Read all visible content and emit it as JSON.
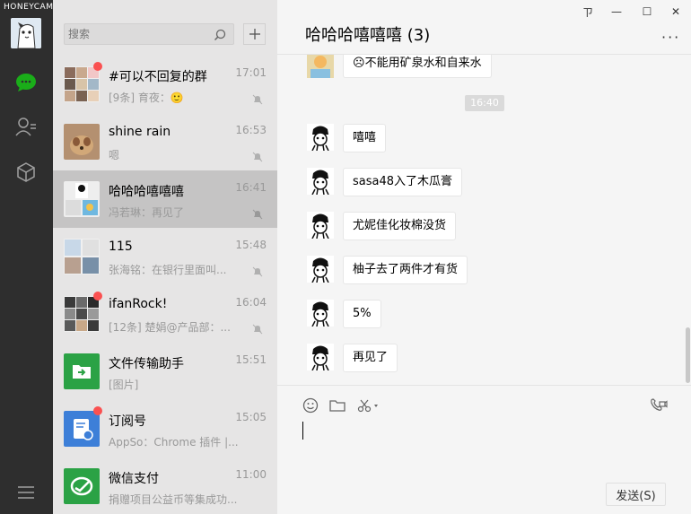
{
  "watermark": "HONEYCAM",
  "search": {
    "placeholder": "搜索"
  },
  "sessions": [
    {
      "name": "#可以不回复的群",
      "time": "17:01",
      "snippet": "[9条] 育夜：🙂",
      "unread": true,
      "muted": true,
      "active": false
    },
    {
      "name": "shine rain",
      "time": "16:53",
      "snippet": "嗯",
      "unread": false,
      "muted": true,
      "active": false
    },
    {
      "name": "哈哈哈嘻嘻嘻",
      "time": "16:41",
      "snippet": "冯若琳：再见了",
      "unread": false,
      "muted": true,
      "active": true
    },
    {
      "name": "115",
      "time": "15:48",
      "snippet": "张海铭：在银行里面叫...",
      "unread": false,
      "muted": true,
      "active": false
    },
    {
      "name": "ifanRock!",
      "time": "16:04",
      "snippet": "[12条] 楚娟@产品部：...",
      "unread": true,
      "muted": true,
      "active": false
    },
    {
      "name": "文件传输助手",
      "time": "15:51",
      "snippet": "[图片]",
      "unread": false,
      "muted": false,
      "active": false
    },
    {
      "name": "订阅号",
      "time": "15:05",
      "snippet": "AppSo：Chrome 插件 |...",
      "unread": true,
      "muted": false,
      "active": false
    },
    {
      "name": "微信支付",
      "time": "11:00",
      "snippet": "捐赠项目公益币等集成功...",
      "unread": false,
      "muted": false,
      "active": false
    }
  ],
  "chat": {
    "title": "哈哈哈嘻嘻嘻 (3)",
    "more_label": "···",
    "time_divider": "16:40",
    "messages": [
      "不能用矿泉水和自来水",
      "嘻嘻",
      "sasa48入了木瓜膏",
      "尤妮佳化妆棉没货",
      "柚子去了两件才有货",
      "5%",
      "再见了"
    ],
    "send_label": "发送(S)"
  },
  "window": {
    "pin": "ㄗ",
    "minimize": "—",
    "maximize": "☐",
    "close": "✕"
  },
  "colors": {
    "rail": "#2e2e2e",
    "list": "#e6e5e5",
    "active": "#c5c4c4",
    "chat": "#f5f5f5",
    "accent": "#1aad19",
    "badge": "#fa5151"
  }
}
